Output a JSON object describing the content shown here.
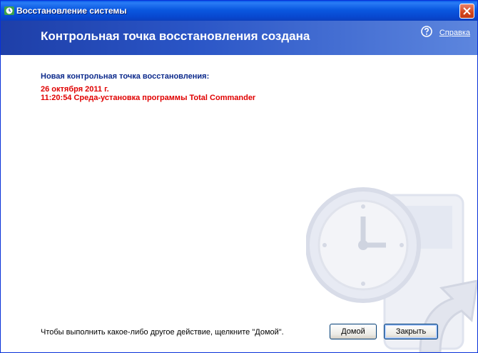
{
  "window": {
    "title": "Восстановление системы"
  },
  "header": {
    "title": "Контрольная точка восстановления создана",
    "help_label": "Справка"
  },
  "content": {
    "heading": "Новая контрольная точка восстановления:",
    "date": "26 октября 2011 г.",
    "entry": "11:20:54  Среда-установка программы Total Commander"
  },
  "footer": {
    "hint": "Чтобы выполнить какое-либо другое действие, щелкните \"Домой\".",
    "home_label": "Домой",
    "close_label": "Закрыть"
  },
  "colors": {
    "title_blue": "#0a58e0",
    "heading_blue": "#0c2a8c",
    "red": "#e00000"
  },
  "icons": [
    "system-restore-icon",
    "close-icon",
    "help-icon",
    "clock-watermark-icon"
  ]
}
